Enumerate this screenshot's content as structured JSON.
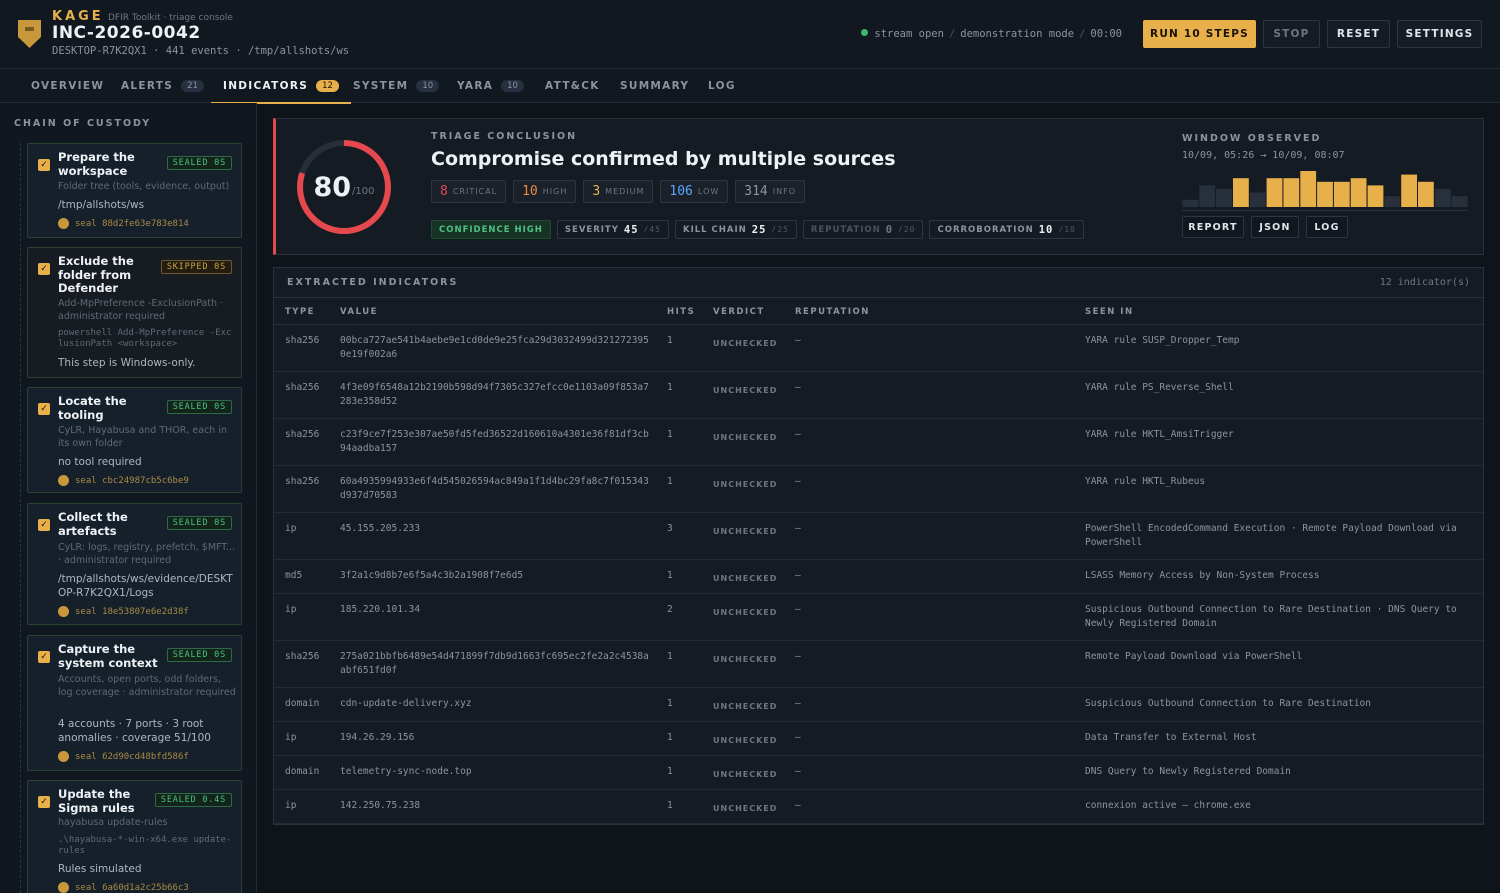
{
  "header": {
    "brand": "KAGE",
    "brand_sub": "DFIR Toolkit · triage console",
    "incident_id": "INC-2026-0042",
    "meta": "DESKTOP-R7K2QX1 · 441 events · /tmp/allshots/ws",
    "stream_status": "stream open",
    "mode": "demonstration mode",
    "timer": "00:00",
    "buttons": {
      "run": "RUN 10 STEPS",
      "stop": "STOP",
      "reset": "RESET",
      "settings": "SETTINGS"
    }
  },
  "tabs": [
    {
      "label": "OVERVIEW",
      "badge": ""
    },
    {
      "label": "ALERTS",
      "badge": "21"
    },
    {
      "label": "INDICATORS",
      "badge": "12"
    },
    {
      "label": "SYSTEM",
      "badge": "10"
    },
    {
      "label": "YARA",
      "badge": "10"
    },
    {
      "label": "ATT&CK",
      "badge": ""
    },
    {
      "label": "SUMMARY",
      "badge": ""
    },
    {
      "label": "LOG",
      "badge": ""
    }
  ],
  "sidebar": {
    "title": "CHAIN OF CUSTODY",
    "steps": [
      {
        "title": "Prepare the workspace",
        "tag": "SEALED 0S",
        "desc": "Folder tree (tools, evidence, output)",
        "cmd": "",
        "output": "/tmp/allshots/ws",
        "seal": "seal 88d2fe63e783e814"
      },
      {
        "title": "Exclude the folder from Defender",
        "tag": "SKIPPED 0S",
        "desc": "Add-MpPreference -ExclusionPath · administrator required",
        "cmd": "powershell Add-MpPreference -ExclusionPath <workspace>",
        "output": "This step is Windows-only.",
        "seal": ""
      },
      {
        "title": "Locate the tooling",
        "tag": "SEALED 0S",
        "desc": "CyLR, Hayabusa and THOR, each in its own folder",
        "cmd": "",
        "output": "no tool required",
        "seal": "seal cbc24987cb5c6be9"
      },
      {
        "title": "Collect the artefacts",
        "tag": "SEALED 0S",
        "desc": "CyLR: logs, registry, prefetch, $MFT... · administrator required",
        "cmd": "",
        "output": "/tmp/allshots/ws/evidence/DESKTOP-R7K2QX1/Logs",
        "seal": "seal 18e53807e6e2d38f"
      },
      {
        "title": "Capture the system context",
        "tag": "SEALED 0S",
        "desc": "Accounts, open ports, odd folders, log coverage · administrator required",
        "cmd": "",
        "output": "4 accounts · 7 ports · 3 root anomalies · coverage 51/100",
        "seal": "seal 62d90cd48bfd586f"
      },
      {
        "title": "Update the Sigma rules",
        "tag": "SEALED 0.4S",
        "desc": "hayabusa update-rules",
        "cmd": ".\\hayabusa-*-win-x64.exe update-rules",
        "output": "Rules simulated",
        "seal": "seal 6a60d1a2c25b66c3"
      }
    ]
  },
  "conclusion": {
    "score": "80",
    "score_max": "/100",
    "score_value": 80,
    "label": "TRIAGE CONCLUSION",
    "title": "Compromise confirmed by multiple sources",
    "severity": [
      {
        "count": "8",
        "label": "critical",
        "color": "#e5484d"
      },
      {
        "count": "10",
        "label": "high",
        "color": "#f0883e"
      },
      {
        "count": "3",
        "label": "medium",
        "color": "#e8b04a"
      },
      {
        "count": "106",
        "label": "low",
        "color": "#58a6ff"
      },
      {
        "count": "314",
        "label": "info",
        "color": "#8b949e"
      }
    ],
    "confidence": "CONFIDENCE HIGH",
    "scores": [
      {
        "label": "SEVERITY",
        "value": "45",
        "max": "/45"
      },
      {
        "label": "KILL CHAIN",
        "value": "25",
        "max": "/25"
      },
      {
        "label": "REPUTATION",
        "value": "0",
        "max": "/20"
      },
      {
        "label": "CORROBORATION",
        "value": "10",
        "max": "/10"
      }
    ],
    "window_label": "WINDOW OBSERVED",
    "window_range": "10/09, 05:26 → 10/09, 08:07",
    "histogram": [
      2,
      6,
      5,
      8,
      4,
      8,
      8,
      10,
      7,
      7,
      8,
      6,
      3,
      9,
      7,
      5,
      3
    ],
    "histogram_hot": [
      false,
      false,
      false,
      true,
      false,
      true,
      true,
      true,
      true,
      true,
      true,
      true,
      false,
      true,
      true,
      false,
      false
    ],
    "buttons": {
      "report": "REPORT",
      "json": "JSON",
      "log": "LOG"
    }
  },
  "indicators": {
    "title": "EXTRACTED INDICATORS",
    "count": "12 indicator(s)",
    "columns": {
      "type": "TYPE",
      "value": "VALUE",
      "hits": "HITS",
      "verdict": "VERDICT",
      "reputation": "REPUTATION",
      "seen": "SEEN IN"
    },
    "rows": [
      {
        "type": "sha256",
        "value": "00bca727ae541b4aebe9e1cd0de9e25fca29d3032499d3212723950e19f002a6",
        "hits": "1",
        "verdict": "UNCHECKED",
        "rep": "—",
        "seen": "YARA rule SUSP_Dropper_Temp"
      },
      {
        "type": "sha256",
        "value": "4f3e09f6548a12b2190b598d94f7305c327efcc0e1103a09f853a7283e358d52",
        "hits": "1",
        "verdict": "UNCHECKED",
        "rep": "—",
        "seen": "YARA rule PS_Reverse_Shell"
      },
      {
        "type": "sha256",
        "value": "c23f9ce7f253e307ae50fd5fed36522d160610a4301e36f81df3cb94aadba157",
        "hits": "1",
        "verdict": "UNCHECKED",
        "rep": "—",
        "seen": "YARA rule HKTL_AmsiTrigger"
      },
      {
        "type": "sha256",
        "value": "60a4935994933e6f4d545026594ac849a1f1d4bc29fa8c7f015343d937d70583",
        "hits": "1",
        "verdict": "UNCHECKED",
        "rep": "—",
        "seen": "YARA rule HKTL_Rubeus"
      },
      {
        "type": "ip",
        "value": "45.155.205.233",
        "hits": "3",
        "verdict": "UNCHECKED",
        "rep": "—",
        "seen": "PowerShell EncodedCommand Execution · Remote Payload Download via PowerShell"
      },
      {
        "type": "md5",
        "value": "3f2a1c9d8b7e6f5a4c3b2a1908f7e6d5",
        "hits": "1",
        "verdict": "UNCHECKED",
        "rep": "—",
        "seen": "LSASS Memory Access by Non-System Process"
      },
      {
        "type": "ip",
        "value": "185.220.101.34",
        "hits": "2",
        "verdict": "UNCHECKED",
        "rep": "—",
        "seen": "Suspicious Outbound Connection to Rare Destination · DNS Query to Newly Registered Domain"
      },
      {
        "type": "sha256",
        "value": "275a021bbfb6489e54d471899f7db9d1663fc695ec2fe2a2c4538aabf651fd0f",
        "hits": "1",
        "verdict": "UNCHECKED",
        "rep": "—",
        "seen": "Remote Payload Download via PowerShell"
      },
      {
        "type": "domain",
        "value": "cdn-update-delivery.xyz",
        "hits": "1",
        "verdict": "UNCHECKED",
        "rep": "—",
        "seen": "Suspicious Outbound Connection to Rare Destination"
      },
      {
        "type": "ip",
        "value": "194.26.29.156",
        "hits": "1",
        "verdict": "UNCHECKED",
        "rep": "—",
        "seen": "Data Transfer to External Host"
      },
      {
        "type": "domain",
        "value": "telemetry-sync-node.top",
        "hits": "1",
        "verdict": "UNCHECKED",
        "rep": "—",
        "seen": "DNS Query to Newly Registered Domain"
      },
      {
        "type": "ip",
        "value": "142.250.75.238",
        "hits": "1",
        "verdict": "UNCHECKED",
        "rep": "—",
        "seen": "connexion active — chrome.exe"
      }
    ]
  }
}
